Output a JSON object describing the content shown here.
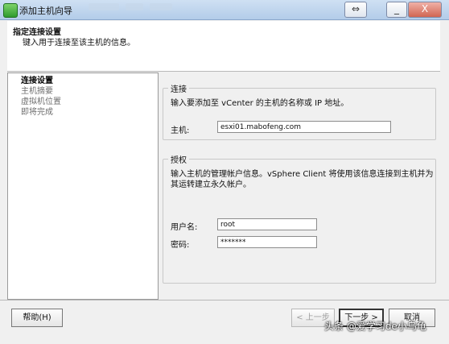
{
  "window": {
    "title": "添加主机向导",
    "restore_glyph": "⇔",
    "min_glyph": "_",
    "close_glyph": "X"
  },
  "header": {
    "title": "指定连接设置",
    "subtitle": "键入用于连接至该主机的信息。"
  },
  "steps": [
    {
      "label": "连接设置",
      "active": true
    },
    {
      "label": "主机摘要",
      "active": false
    },
    {
      "label": "虚拟机位置",
      "active": false
    },
    {
      "label": "即将完成",
      "active": false
    }
  ],
  "connection": {
    "legend": "连接",
    "description": "输入要添加至 vCenter 的主机的名称或 IP 地址。",
    "host_label": "主机:",
    "host_value": "esxi01.mabofeng.com"
  },
  "authorization": {
    "legend": "授权",
    "description_line1": "输入主机的管理帐户信息。vSphere Client 将使用该信息连接到主机并为",
    "description_line2": "其运转建立永久帐户。",
    "username_label": "用户名:",
    "username_value": "root",
    "password_label": "密码:",
    "password_value": "*******"
  },
  "buttons": {
    "help": "帮助(H)",
    "back": "< 上一步",
    "next": "下一步 >",
    "cancel": "取消"
  },
  "watermark": "头条 @爱学习de小乌龟",
  "icons": {
    "app": "green-app-icon"
  }
}
